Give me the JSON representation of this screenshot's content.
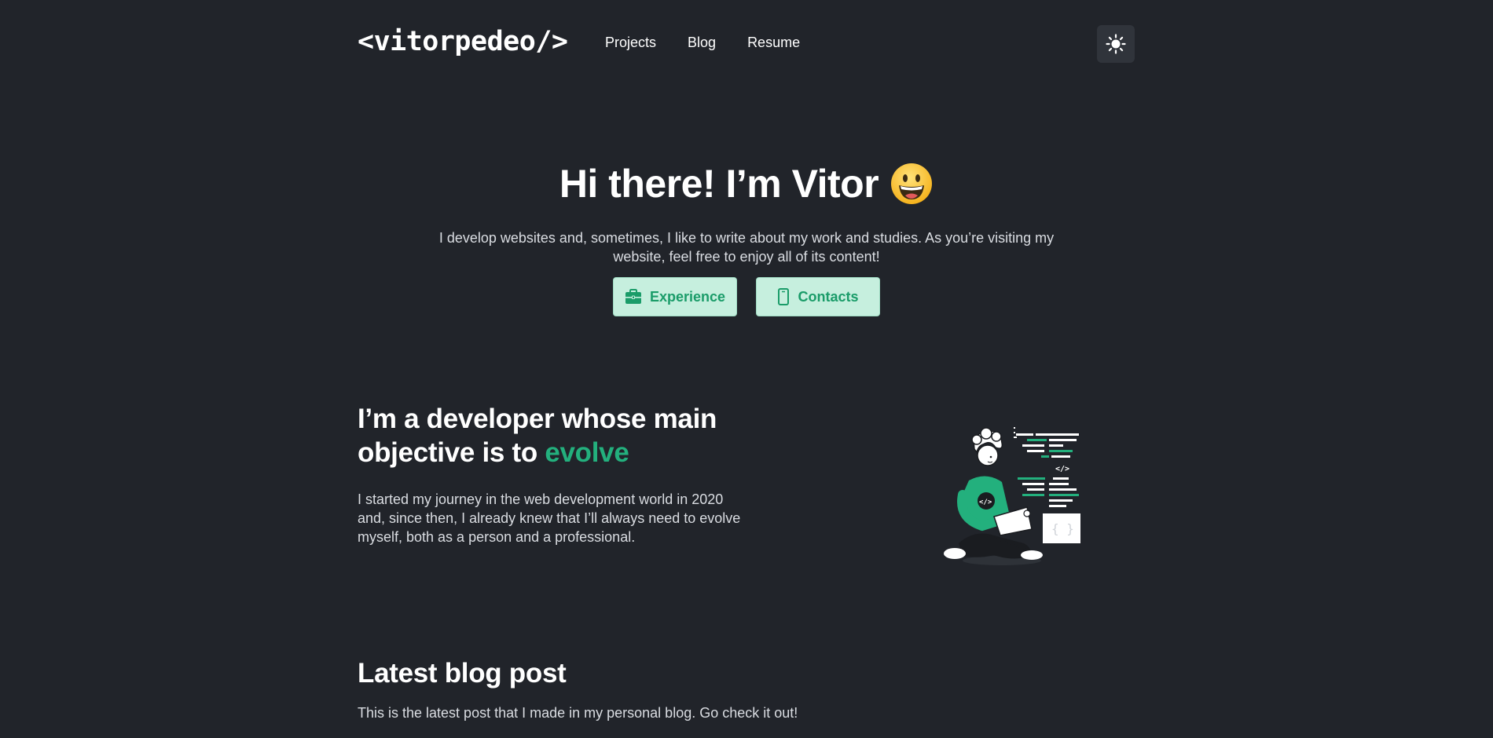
{
  "header": {
    "logo": "<vitorpedeo/>",
    "nav": [
      "Projects",
      "Blog",
      "Resume"
    ],
    "theme_toggle_icon": "sun-icon"
  },
  "hero": {
    "greeting": "Hi there! I’m Vitor",
    "emoji_icon": "grinning-face-icon",
    "description": "I develop websites and, sometimes, I like to write about my work and studies. As you’re visiting my website, feel free to enjoy all of its content!",
    "buttons": [
      {
        "label": "Experience",
        "icon": "briefcase-icon"
      },
      {
        "label": "Contacts",
        "icon": "smartphone-icon"
      }
    ]
  },
  "about": {
    "heading_start": "I’m a developer whose main objective is to ",
    "heading_accent": "evolve",
    "body": "I started my journey in the web development world in 2020 and, since then, I already knew that I’ll always need to evolve myself, both as a person and a professional.",
    "illustration_code_tag": "</>"
  },
  "latest": {
    "title": "Latest blog post",
    "description": "This is the latest post that I made in my personal blog. Go check it out!"
  },
  "colors": {
    "background": "#21242a",
    "accent": "#23b07d",
    "button_bg": "#c6efde",
    "button_text": "#1a9c69"
  }
}
